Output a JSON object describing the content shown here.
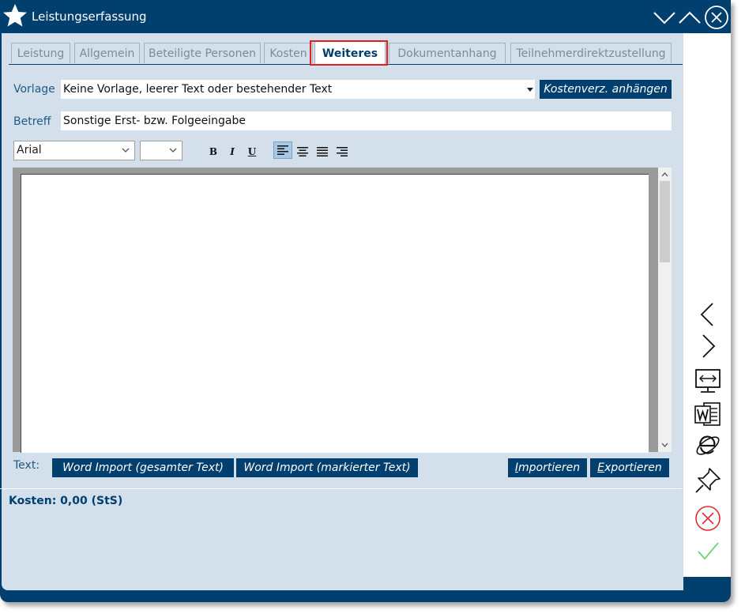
{
  "window": {
    "title": "Leistungserfassung"
  },
  "tabs": [
    {
      "label": "Leistung"
    },
    {
      "label": "Allgemein"
    },
    {
      "label": "Beteiligte Personen"
    },
    {
      "label": "Kosten"
    },
    {
      "label": "Weiteres",
      "active": true
    },
    {
      "label": "Dokumentanhang"
    },
    {
      "label": "Teilnehmerdirektzustellung"
    }
  ],
  "form": {
    "vorlage_label": "Vorlage",
    "vorlage_value": "Keine Vorlage, leerer Text oder bestehender Text",
    "kostenverz_button": "Kostenverz. anhängen",
    "betreff_label": "Betreff",
    "betreff_value": "Sonstige Erst- bzw. Folgeeingabe"
  },
  "toolbar": {
    "font_value": "Arial",
    "size_value": "",
    "bold": "B",
    "italic": "I",
    "underline": "U"
  },
  "text_actions": {
    "label": "Text:",
    "word_import_all": "Word Import (gesamter Text)",
    "word_import_marked": "Word Import (markierter Text)",
    "import_first": "I",
    "import_rest": "mportieren",
    "export_first": "E",
    "export_rest": "xportieren"
  },
  "footer": {
    "cost": "Kosten: 0,00 (StS)"
  },
  "colors": {
    "accent": "#003f6e",
    "panel": "#d3e0ec",
    "highlight": "#e02020"
  },
  "icons": {
    "titlebar": [
      "star-icon",
      "minimize-icon",
      "maximize-icon",
      "close-icon"
    ],
    "sidebar": [
      "previous-icon",
      "next-icon",
      "screen-switch-icon",
      "word-icon",
      "internet-explorer-icon",
      "pin-icon",
      "cancel-icon",
      "confirm-icon"
    ]
  }
}
